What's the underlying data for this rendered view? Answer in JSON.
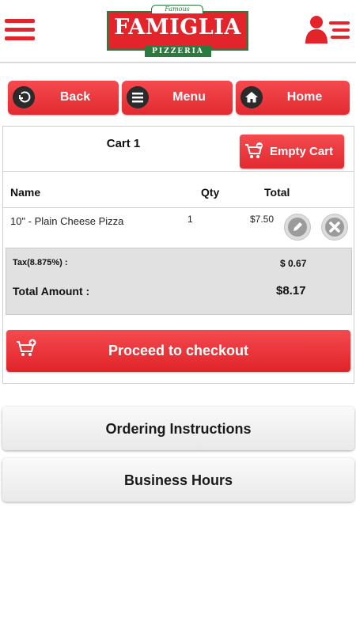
{
  "header": {
    "menu_icon": "hamburger-icon",
    "logo": {
      "top_text": "Famous",
      "name": "FAMIGLIA",
      "subtitle": "PIZZERIA"
    },
    "account_icon": "user-list-icon",
    "brand_color": "#e3242b",
    "logo_green": "#2a7b3d"
  },
  "nav": [
    {
      "label": "Back",
      "icon": "back-arrow-icon"
    },
    {
      "label": "Menu",
      "icon": "menu-lines-icon"
    },
    {
      "label": "Home",
      "icon": "home-icon"
    }
  ],
  "cart": {
    "title": "Cart 1",
    "empty_label": "Empty Cart",
    "columns": {
      "name": "Name",
      "qty": "Qty",
      "total": "Total"
    },
    "items": [
      {
        "name": "10\" - Plain Cheese Pizza",
        "qty": "1",
        "total": "$7.50"
      }
    ],
    "tax_label": "Tax(8.875%) :",
    "tax_value": "$ 0.67",
    "total_label": "Total Amount :",
    "total_value": "$8.17",
    "checkout_label": "Proceed to checkout"
  },
  "sections": [
    {
      "label": "Ordering Instructions"
    },
    {
      "label": "Business Hours"
    }
  ]
}
